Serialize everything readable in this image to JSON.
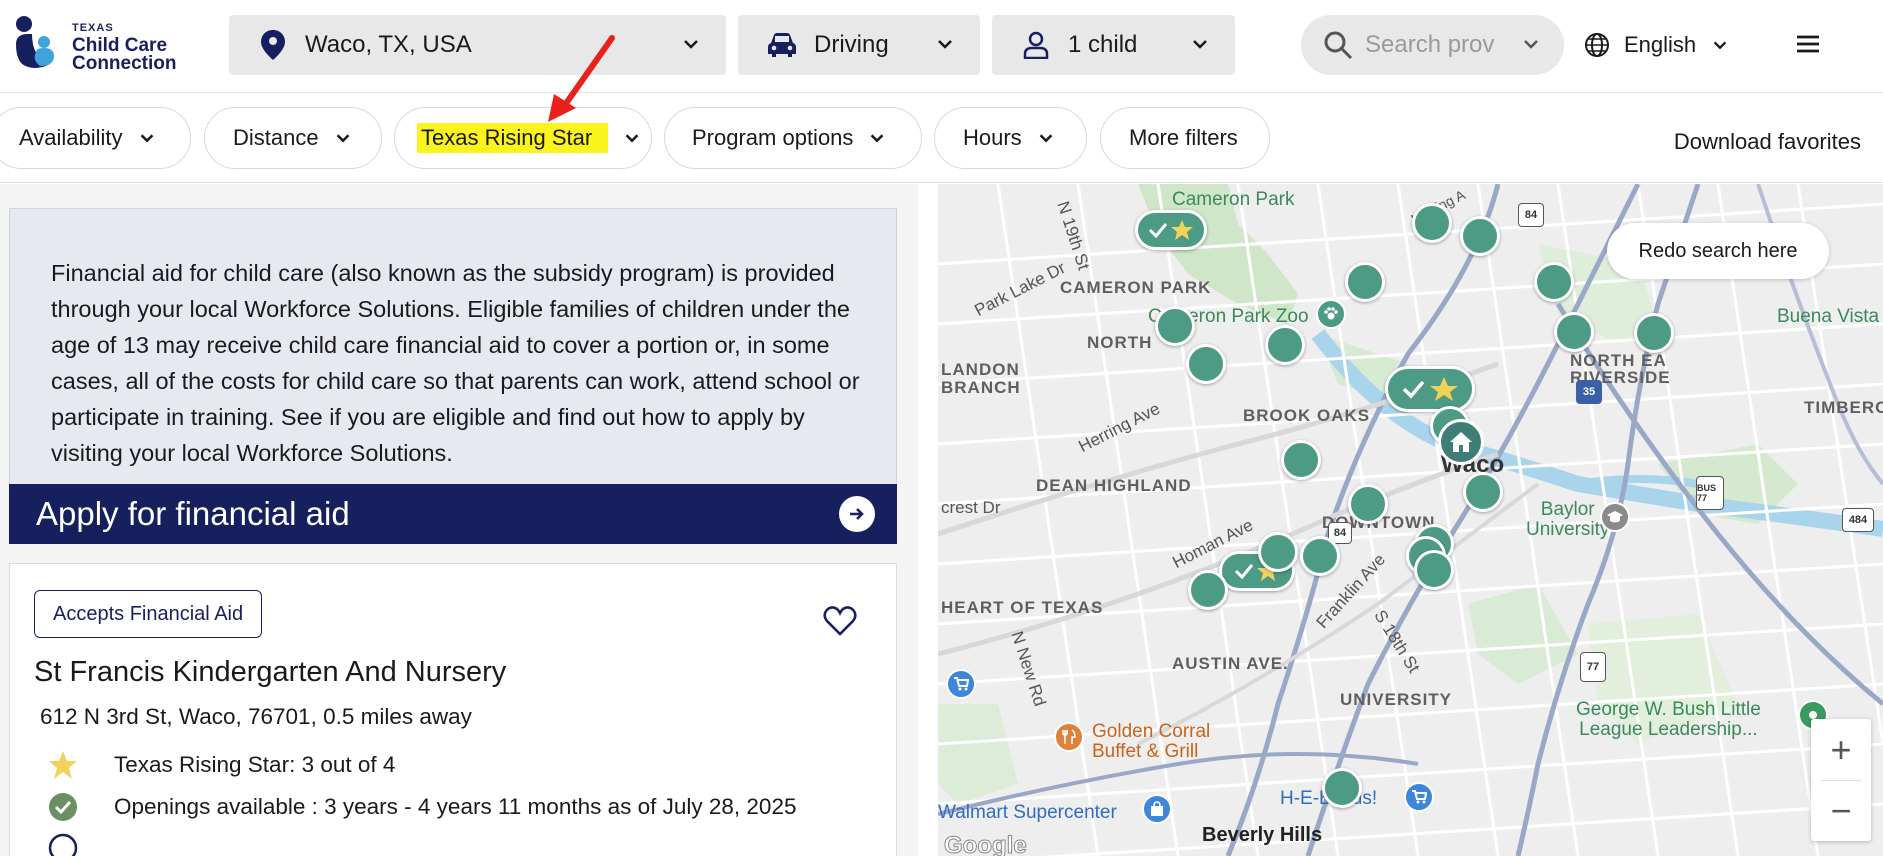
{
  "header": {
    "logo": {
      "line1": "TEXAS",
      "line2": "Child Care",
      "line3": "Connection"
    },
    "location": {
      "value": "Waco, TX, USA",
      "icon": "map-pin-icon"
    },
    "travel_mode": {
      "value": "Driving",
      "icon": "car-icon"
    },
    "children": {
      "value": "1 child",
      "icon": "person-icon"
    },
    "search": {
      "placeholder": "Search prov"
    },
    "language": {
      "value": "English",
      "icon": "globe-icon"
    }
  },
  "filters": {
    "items": [
      {
        "label": "Availability"
      },
      {
        "label": "Distance"
      },
      {
        "label": "Texas Rising Star",
        "highlighted": true
      },
      {
        "label": "Program options"
      },
      {
        "label": "Hours"
      },
      {
        "label": "More filters"
      }
    ],
    "download_label": "Download favorites"
  },
  "financial_aid": {
    "text": "Financial aid for child care (also known as the subsidy program) is provided through your local Workforce Solutions. Eligible families of children under the age of 13 may receive child care financial aid to cover a portion or, in some cases, all of the costs for child care so that parents can work, attend school or participate in training. See if you are eligible and find out how to apply by visiting your local Workforce Solutions.",
    "apply_label": "Apply for financial aid"
  },
  "provider_card": {
    "badge": "Accepts Financial Aid",
    "name": "St Francis Kindergarten And Nursery",
    "address": "612 N 3rd St, Waco, 76701, 0.5 miles away",
    "rating_line": "Texas Rising Star: 3 out of 4",
    "openings_line": "Openings available : 3 years - 4 years 11 months as of July 28, 2025",
    "rating_stars": 3,
    "rating_max": 4
  },
  "map": {
    "redo_label": "Redo search here",
    "zoom_in": "+",
    "zoom_out": "−",
    "labels": {
      "cameron_park": "Cameron Park",
      "cameron_park_upper": "CAMERON PARK",
      "cameron_park_zoo": "Cameron Park Zoo",
      "north": "NORTH",
      "brook_oaks": "BROOK OAKS",
      "dean_highland": "DEAN HIGHLAND",
      "downtown": "DOWNTOWN",
      "waco": "Waco",
      "baylor": "Baylor\nUniversity",
      "heart_of_texas": "HEART OF TEXAS",
      "austin_ave": "AUSTIN AVE.",
      "university": "UNIVERSITY",
      "riverside": "RIVERSIDE",
      "north_east": "NORTH EA",
      "timbercrest": "TIMBERCRE",
      "buena_vista": "Buena Vista",
      "landon_branch_1": "LANDON",
      "landon_branch_2": "BRANCH",
      "park_lake_dr": "Park Lake Dr",
      "herring_ave": "Herring Ave",
      "homan_ave": "Homan Ave",
      "franklin_ave": "Franklin Ave",
      "s18th": "S 18th St",
      "nnew_rd": "N New Rd",
      "n19th": "N 19th St",
      "crest_dr": "crest Dr",
      "herring_a": "Herring A",
      "golden_corral": "Golden Corral\nBuffet & Grill",
      "walmart": "Walmart Supercenter",
      "heb": "H-E-B plus!",
      "beverly_hills": "Beverly Hills",
      "gwbush": "George W. Bush Little\nLeague Leadership...",
      "google": "Google",
      "shield_84": "84",
      "shield_35": "35",
      "shield_bus77": "BUS 77",
      "shield_77": "77",
      "shield_484": "484",
      "shield_84b": "84"
    }
  },
  "colors": {
    "navy": "#17205e",
    "marker_green": "#4d9a85",
    "highlight_yellow": "#fbf31c",
    "annotation_red": "#e8211c",
    "star_yellow": "#f2d35a"
  }
}
